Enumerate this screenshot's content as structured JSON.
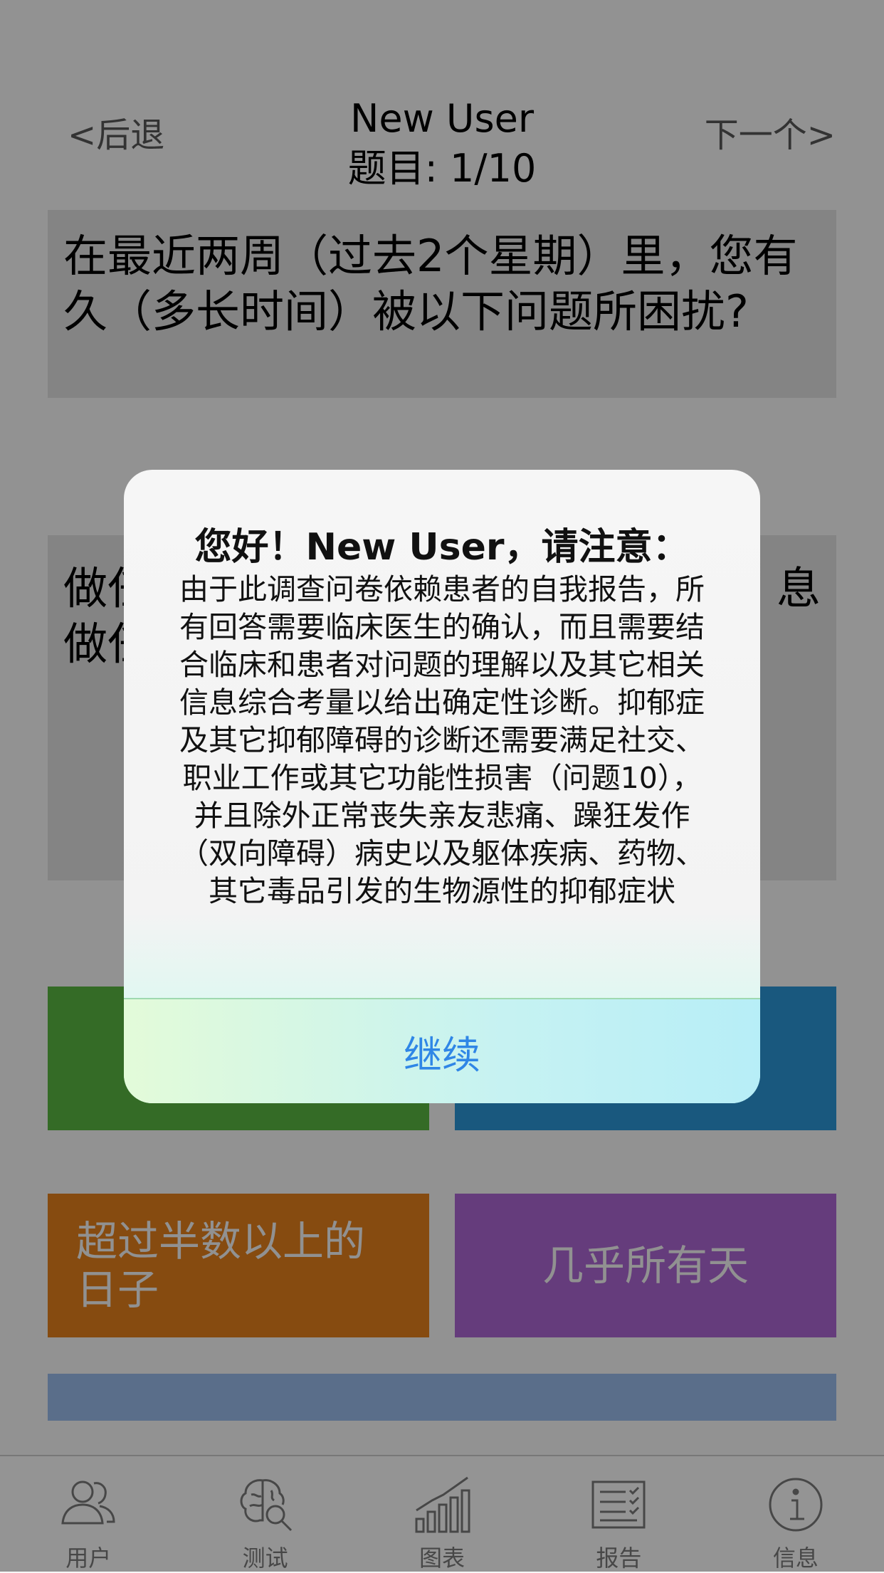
{
  "header": {
    "back_label": "<后退",
    "next_label": "下一个>",
    "user_name": "New User",
    "question_counter": "题目: 1/10"
  },
  "question": {
    "text": "在最近两周（过去2个星期）里，您有久（多长时间）被以下问题所困扰?"
  },
  "sub_question": {
    "line1": "做任",
    "line1_end": "息",
    "line2": "做任"
  },
  "options": [
    {
      "label": "",
      "color": "#57b240"
    },
    {
      "label": "",
      "color": "#2b93d3"
    },
    {
      "label": "超过半数以上的日子",
      "color": "#e07d1c"
    },
    {
      "label": "几乎所有天",
      "color": "#a965cf"
    }
  ],
  "tabbar": {
    "items": [
      {
        "label": "用户",
        "icon": "users-icon"
      },
      {
        "label": "测试",
        "icon": "brain-search-icon"
      },
      {
        "label": "图表",
        "icon": "bar-chart-icon"
      },
      {
        "label": "报告",
        "icon": "report-list-icon"
      },
      {
        "label": "信息",
        "icon": "info-icon"
      }
    ]
  },
  "alert": {
    "title": "您好！New User，请注意：",
    "message": "由于此调查问卷依赖患者的自我报告，所有回答需要临床医生的确认，而且需要结合临床和患者对问题的理解以及其它相关信息综合考量以给出确定性诊断。抑郁症及其它抑郁障碍的诊断还需要满足社交、职业工作或其它功能性损害（问题10），并且除外正常丧失亲友悲痛、躁狂发作（双向障碍）病史以及躯体疾病、药物、其它毒品引发的生物源性的抑郁症状",
    "button_label": "继续"
  },
  "colors": {
    "accent_blue": "#2f86e6",
    "overlay": "rgba(0,0,0,0.40)"
  }
}
